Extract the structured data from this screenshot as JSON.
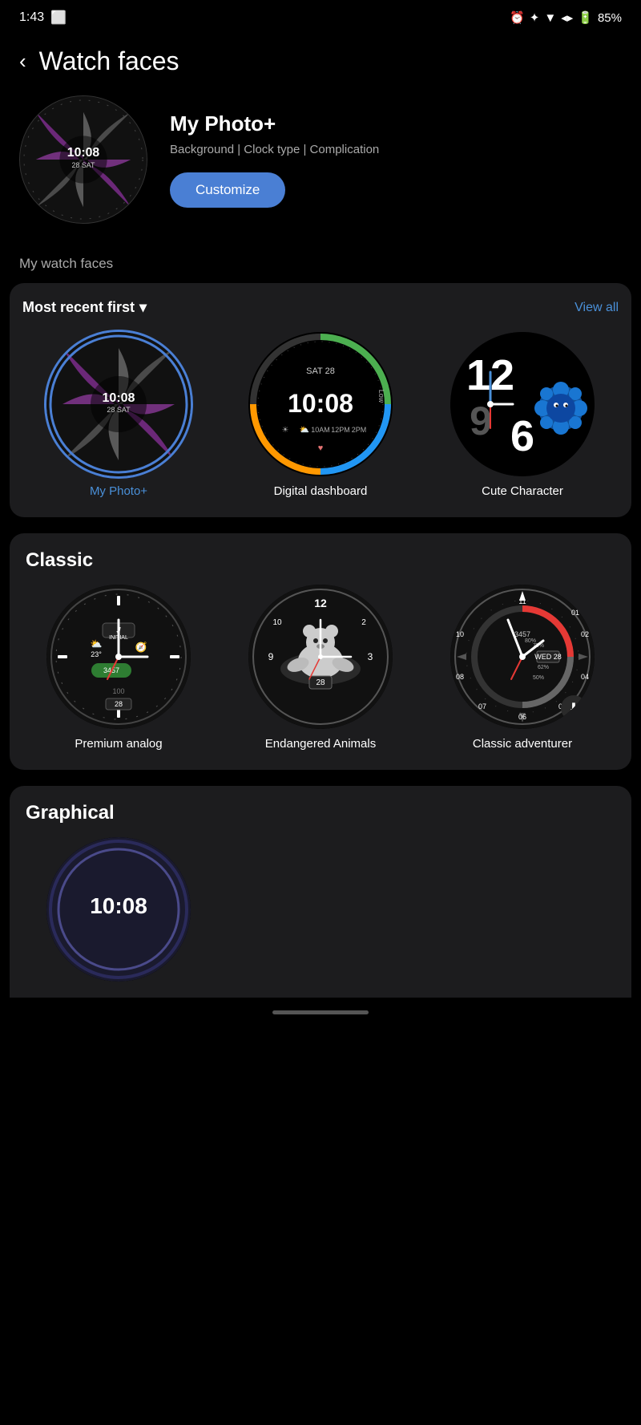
{
  "statusBar": {
    "time": "1:43",
    "battery": "85%",
    "icons": [
      "alarm",
      "bluetooth",
      "wifi",
      "signal",
      "battery"
    ]
  },
  "header": {
    "backLabel": "‹",
    "title": "Watch faces"
  },
  "featured": {
    "name": "My Photo+",
    "description": "Background | Clock type | Complication",
    "customizeLabel": "Customize",
    "clockTime": "10:08",
    "clockDate": "28 SAT"
  },
  "myWatchFaces": {
    "sectionLabel": "My watch faces",
    "sortLabel": "Most recent first",
    "viewAllLabel": "View all",
    "items": [
      {
        "id": "my-photo",
        "label": "My Photo+",
        "active": true,
        "type": "photo"
      },
      {
        "id": "digital-dashboard",
        "label": "Digital dashboard",
        "active": false,
        "type": "digital"
      },
      {
        "id": "cute-character",
        "label": "Cute Character",
        "active": false,
        "type": "cute"
      }
    ]
  },
  "classic": {
    "sectionLabel": "Classic",
    "items": [
      {
        "id": "premium-analog",
        "label": "Premium analog",
        "type": "premium"
      },
      {
        "id": "endangered-animals",
        "label": "Endangered Animals",
        "type": "animals"
      },
      {
        "id": "classic-adventurer",
        "label": "Classic adventurer",
        "type": "adventurer",
        "hasDownload": true
      }
    ]
  },
  "graphical": {
    "sectionLabel": "Graphical"
  }
}
